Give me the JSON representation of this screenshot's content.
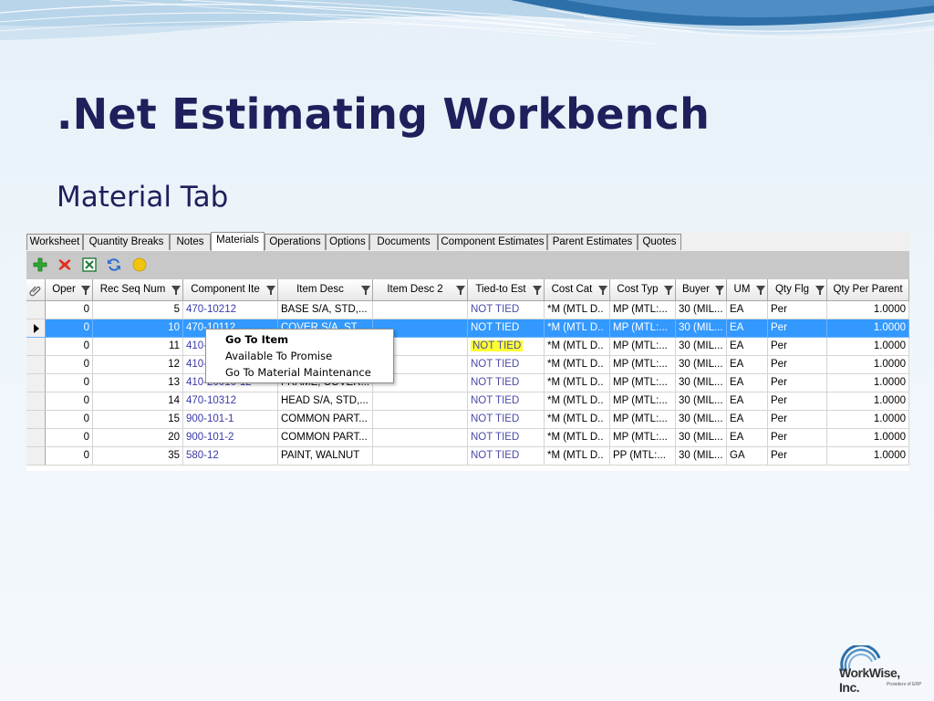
{
  "slide": {
    "title": ".Net Estimating Workbench",
    "subtitle": "Material Tab"
  },
  "tabs": [
    {
      "label": "Worksheet"
    },
    {
      "label": "Quantity Breaks"
    },
    {
      "label": "Notes"
    },
    {
      "label": "Materials",
      "active": true
    },
    {
      "label": "Operations"
    },
    {
      "label": "Options"
    },
    {
      "label": "Documents"
    },
    {
      "label": "Component Estimates"
    },
    {
      "label": "Parent Estimates"
    },
    {
      "label": "Quotes"
    }
  ],
  "toolbar": [
    {
      "icon": "add-icon",
      "color": "#2ea82e"
    },
    {
      "icon": "delete-icon",
      "color": "#e0301e"
    },
    {
      "icon": "excel-icon",
      "color": "#1e7a3a"
    },
    {
      "icon": "refresh-icon",
      "color": "#2f6fd0"
    },
    {
      "icon": "status-light-icon",
      "color": "#f2c40f"
    }
  ],
  "columns": [
    {
      "label": "",
      "icon": "paperclip-icon"
    },
    {
      "label": "Oper"
    },
    {
      "label": "Rec Seq Num"
    },
    {
      "label": "Component Ite"
    },
    {
      "label": "Item Desc"
    },
    {
      "label": "Item Desc 2"
    },
    {
      "label": "Tied-to Est"
    },
    {
      "label": "Cost Cat"
    },
    {
      "label": "Cost Typ"
    },
    {
      "label": "Buyer"
    },
    {
      "label": "UM"
    },
    {
      "label": "Qty Flg"
    },
    {
      "label": "Qty Per Parent"
    }
  ],
  "rows": [
    {
      "oper": "0",
      "seq": "5",
      "item": "470-10212",
      "desc": "BASE S/A, STD,...",
      "desc2": "",
      "tied": "NOT TIED",
      "costcat": "*M (MTL D..",
      "costtyp": "MP (MTL:...",
      "buyer": "30 (MIL...",
      "um": "EA",
      "qtyflg": "Per",
      "qty": "1.0000"
    },
    {
      "oper": "0",
      "seq": "10",
      "item": "470-10112",
      "desc": "COVER S/A, ST...",
      "desc2": "",
      "tied": "NOT TIED",
      "costcat": "*M (MTL D..",
      "costtyp": "MP (MTL:...",
      "buyer": "30 (MIL...",
      "um": "EA",
      "qtyflg": "Per",
      "qty": "1.0000",
      "selected": true
    },
    {
      "oper": "0",
      "seq": "11",
      "item": "410-",
      "desc": "",
      "desc2": "",
      "tied": "NOT TIED",
      "costcat": "*M (MTL D..",
      "costtyp": "MP (MTL:...",
      "buyer": "30 (MIL...",
      "um": "EA",
      "qtyflg": "Per",
      "qty": "1.0000",
      "highlight": true
    },
    {
      "oper": "0",
      "seq": "12",
      "item": "410-",
      "desc": "",
      "desc2": "",
      "tied": "NOT TIED",
      "costcat": "*M (MTL D..",
      "costtyp": "MP (MTL:...",
      "buyer": "30 (MIL...",
      "um": "EA",
      "qtyflg": "Per",
      "qty": "1.0000"
    },
    {
      "oper": "0",
      "seq": "13",
      "item": "410-20010-12",
      "desc": "FRAME, COVER...",
      "desc2": "",
      "tied": "NOT TIED",
      "costcat": "*M (MTL D..",
      "costtyp": "MP (MTL:...",
      "buyer": "30 (MIL...",
      "um": "EA",
      "qtyflg": "Per",
      "qty": "1.0000"
    },
    {
      "oper": "0",
      "seq": "14",
      "item": "470-10312",
      "desc": "HEAD S/A, STD,...",
      "desc2": "",
      "tied": "NOT TIED",
      "costcat": "*M (MTL D..",
      "costtyp": "MP (MTL:...",
      "buyer": "30 (MIL...",
      "um": "EA",
      "qtyflg": "Per",
      "qty": "1.0000"
    },
    {
      "oper": "0",
      "seq": "15",
      "item": "900-101-1",
      "desc": "COMMON PART...",
      "desc2": "",
      "tied": "NOT TIED",
      "costcat": "*M (MTL D..",
      "costtyp": "MP (MTL:...",
      "buyer": "30 (MIL...",
      "um": "EA",
      "qtyflg": "Per",
      "qty": "1.0000"
    },
    {
      "oper": "0",
      "seq": "20",
      "item": "900-101-2",
      "desc": "COMMON PART...",
      "desc2": "",
      "tied": "NOT TIED",
      "costcat": "*M (MTL D..",
      "costtyp": "MP (MTL:...",
      "buyer": "30 (MIL...",
      "um": "EA",
      "qtyflg": "Per",
      "qty": "1.0000"
    },
    {
      "oper": "0",
      "seq": "35",
      "item": "580-12",
      "desc": "PAINT, WALNUT",
      "desc2": "",
      "tied": "NOT TIED",
      "costcat": "*M (MTL D..",
      "costtyp": "PP (MTL:...",
      "buyer": "30 (MIL...",
      "um": "GA",
      "qtyflg": "Per",
      "qty": "1.0000"
    }
  ],
  "context_menu": [
    {
      "label": "Go To Item",
      "bold": true
    },
    {
      "label": "Available To Promise"
    },
    {
      "label": "Go To Material Maintenance"
    }
  ],
  "logo": {
    "name": "WorkWise, Inc.",
    "tagline": "Providers of ERP"
  }
}
